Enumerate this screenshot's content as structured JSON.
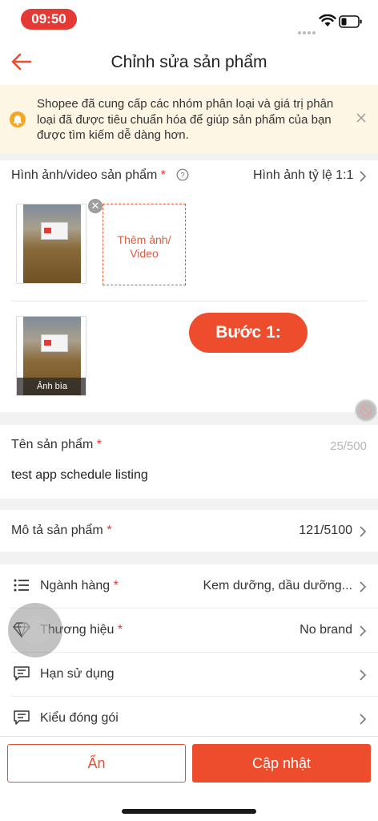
{
  "status_bar": {
    "time": "09:50"
  },
  "header": {
    "title": "Chỉnh sửa sản phẩm"
  },
  "banner": {
    "text": "Shopee đã cung cấp các nhóm phân loại và giá trị phân loại đã được tiêu chuẩn hóa để giúp sản phẩm của bạn được tìm kiếm dễ dàng hơn."
  },
  "media": {
    "label": "Hình ảnh/video sản phẩm",
    "required_mark": "*",
    "ratio_label": "Hình ảnh tỷ lệ 1:1",
    "add_button_line1": "Thêm ảnh/",
    "add_button_line2": "Video",
    "cover_caption": "Ảnh bìa",
    "step_badge": "Bước 1:"
  },
  "product_name": {
    "label": "Tên sản phẩm",
    "required_mark": "*",
    "count": "25/500",
    "value": "test app schedule listing"
  },
  "description": {
    "label": "Mô tả sản phẩm",
    "required_mark": "*",
    "count": "121/5100"
  },
  "attributes": [
    {
      "label": "Ngành hàng",
      "required_mark": "*",
      "value": "Kem dưỡng, dầu dưỡng...",
      "icon": "list-icon"
    },
    {
      "label": "Thương hiệu",
      "required_mark": "*",
      "value": "No brand",
      "icon": "diamond-icon"
    },
    {
      "label": "Hạn sử dụng",
      "required_mark": "",
      "value": "",
      "icon": "message-icon"
    },
    {
      "label": "Kiểu đóng gói",
      "required_mark": "",
      "value": "",
      "icon": "message-icon"
    }
  ],
  "actions": {
    "hide_label": "Ẩn",
    "update_label": "Cập nhật"
  },
  "colors": {
    "brand": "#ee4d2d",
    "banner_bg": "#fef6e4",
    "status_pill": "#e53935"
  }
}
